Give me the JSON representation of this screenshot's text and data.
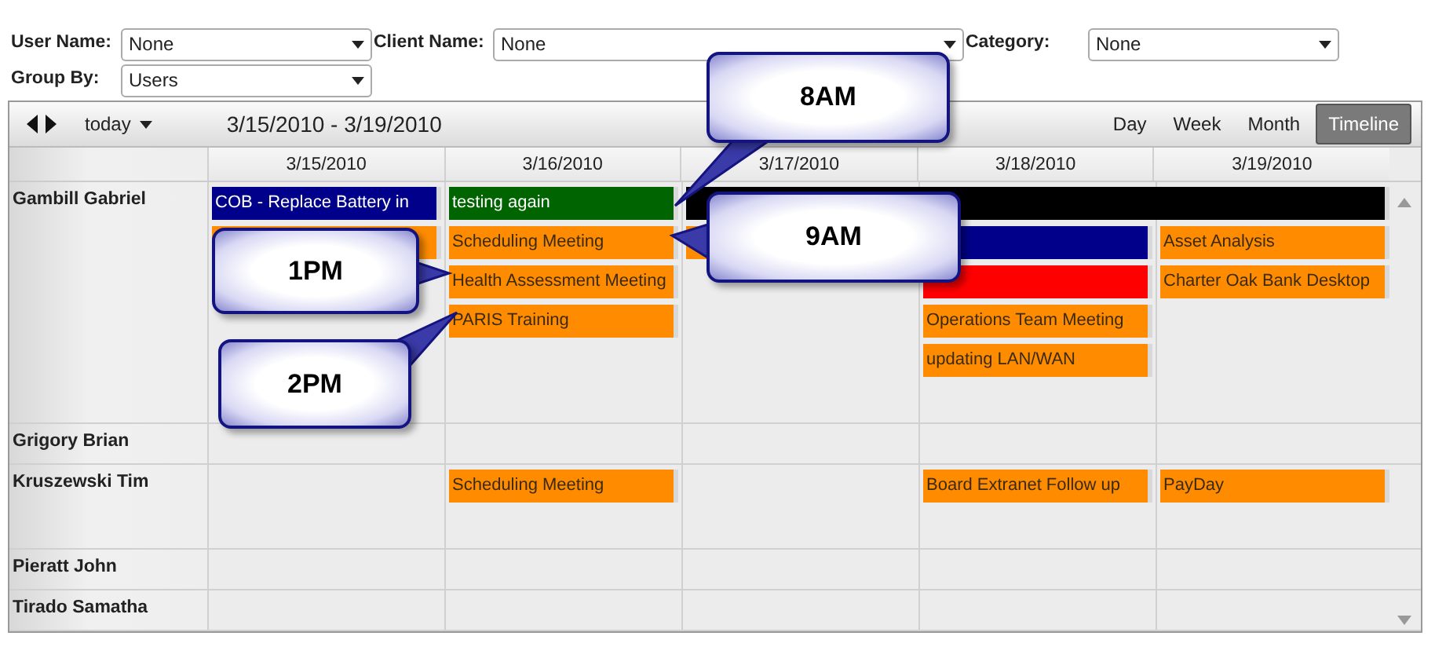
{
  "filters": [
    {
      "label": "User Name:",
      "value": "None"
    },
    {
      "label": "Client Name:",
      "value": "None"
    },
    {
      "label": "Category:",
      "value": "None"
    },
    {
      "label": "Group By:",
      "value": "Users"
    }
  ],
  "toolbar": {
    "today": "today",
    "date_range": "3/15/2010 - 3/19/2010",
    "views": [
      {
        "label": "Day",
        "selected": false
      },
      {
        "label": "Week",
        "selected": false
      },
      {
        "label": "Month",
        "selected": false
      },
      {
        "label": "Timeline",
        "selected": true
      }
    ]
  },
  "days": [
    "3/15/2010",
    "3/16/2010",
    "3/17/2010",
    "3/18/2010",
    "3/19/2010"
  ],
  "resources": [
    {
      "name": "Gambill Gabriel",
      "lanes": [
        [
          {
            "kind": "event",
            "title": "COB - Replace Battery in",
            "color": "#00008b"
          },
          {
            "kind": "event",
            "title": "testing again",
            "color": "#006400"
          },
          {
            "kind": "event",
            "color": "#000000"
          },
          {
            "kind": "continued"
          },
          {
            "kind": "continued"
          }
        ],
        [
          {
            "kind": "event",
            "color": "#ff8c00"
          },
          {
            "kind": "event",
            "title": "Scheduling Meeting",
            "color": "#ff8c00"
          },
          {
            "kind": "event",
            "color": "#ff8c00"
          },
          {
            "kind": "event",
            "color": "#00008b"
          },
          {
            "kind": "event",
            "title": "Asset Analysis",
            "color": "#ff8c00"
          }
        ],
        [
          {
            "kind": "empty"
          },
          {
            "kind": "event",
            "title": "Health Assessment Meeting",
            "color": "#ff8c00"
          },
          {
            "kind": "empty"
          },
          {
            "kind": "event",
            "color": "#ff0000"
          },
          {
            "kind": "event",
            "title": "Charter Oak Bank Desktop",
            "color": "#ff8c00"
          }
        ],
        [
          {
            "kind": "empty"
          },
          {
            "kind": "event",
            "title": "PARIS Training",
            "color": "#ff8c00"
          },
          {
            "kind": "empty"
          },
          {
            "kind": "event",
            "title": "Operations Team Meeting",
            "color": "#ff8c00"
          },
          {
            "kind": "empty"
          }
        ],
        [
          {
            "kind": "empty"
          },
          {
            "kind": "empty"
          },
          {
            "kind": "empty"
          },
          {
            "kind": "event",
            "title": "updating LAN/WAN",
            "color": "#ff8c00"
          },
          {
            "kind": "empty"
          }
        ]
      ]
    },
    {
      "name": "Grigory Brian"
    },
    {
      "name": "Kruszewski Tim",
      "lanes": [
        [
          {
            "kind": "empty"
          },
          {
            "kind": "event",
            "title": "Scheduling Meeting",
            "color": "#ff8c00"
          },
          {
            "kind": "empty"
          },
          {
            "kind": "event",
            "title": "Board Extranet Follow up",
            "color": "#ff8c00"
          },
          {
            "kind": "event",
            "title": "PayDay",
            "color": "#ff8c00"
          }
        ]
      ]
    },
    {
      "name": "Pieratt John"
    },
    {
      "name": "Tirado Samatha"
    }
  ],
  "callouts": [
    {
      "text": "8AM"
    },
    {
      "text": "9AM"
    },
    {
      "text": "1PM"
    },
    {
      "text": "2PM"
    }
  ]
}
